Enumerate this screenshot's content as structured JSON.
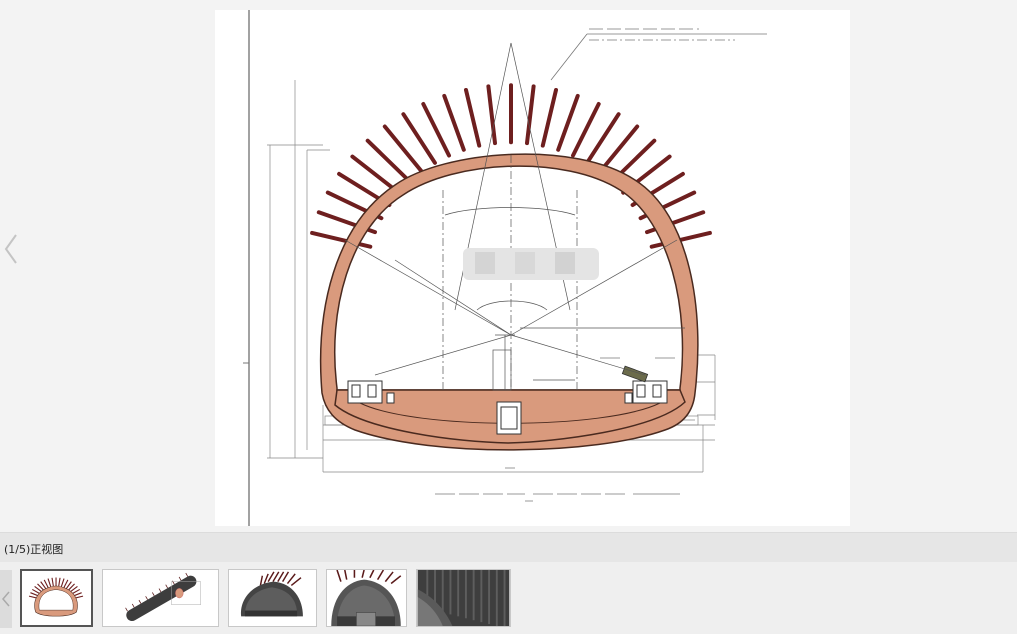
{
  "viewer": {
    "caption": "(1/5)正视图",
    "thumbnails": [
      {
        "name": "thumb-front-view",
        "active": true
      },
      {
        "name": "thumb-iso-long",
        "active": false
      },
      {
        "name": "thumb-iso-short",
        "active": false
      },
      {
        "name": "thumb-iso-close",
        "active": false
      },
      {
        "name": "thumb-detail",
        "active": false
      }
    ]
  },
  "colors": {
    "lining": "#d99a7d",
    "lining_stroke": "#4a2a1f",
    "rockbolt": "#6e1f1f",
    "background": "#f3f3f3"
  },
  "icons": {
    "prev": "chevron-left-icon",
    "strip_prev": "chevron-left-icon"
  }
}
